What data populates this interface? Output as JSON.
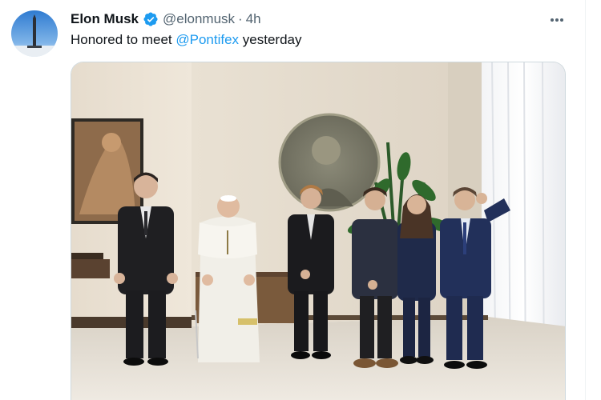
{
  "author": {
    "display_name": "Elon Musk",
    "handle": "@elonmusk",
    "separator": "·",
    "time": "4h",
    "verified_icon": "verified-badge-icon",
    "avatar_icon": "rocket-avatar"
  },
  "tweet": {
    "text_before": "Honored to meet ",
    "mention": "@Pontifex",
    "text_after": " yesterday"
  },
  "menu": {
    "icon": "more-dots-icon"
  },
  "colors": {
    "text": "#0f1419",
    "secondary": "#536471",
    "accent": "#1d9bf0",
    "border": "#cfd9de"
  }
}
